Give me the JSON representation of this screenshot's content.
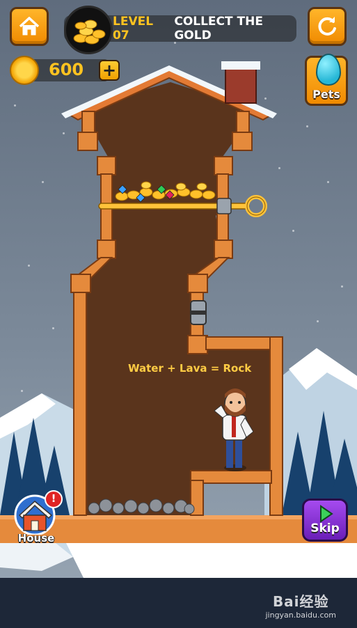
{
  "header": {
    "level_label": "LEVEL 07",
    "mission_title": "COLLECT THE GOLD"
  },
  "currency": {
    "coins": "600",
    "add_symbol": "+"
  },
  "buttons": {
    "pets_label": "Pets",
    "house_label": "House",
    "house_alert": "!",
    "skip_label": "Skip"
  },
  "puzzle": {
    "hint_text": "Water + Lava = Rock"
  },
  "watermark": {
    "brand": "Bai经验",
    "url": "jingyan.baidu.com"
  },
  "colors": {
    "accent_orange": "#f59a10",
    "gold_text": "#ffc320",
    "wood": "#d9823f",
    "dirt": "#5a341c",
    "skip_purple": "#8a2fd6"
  }
}
